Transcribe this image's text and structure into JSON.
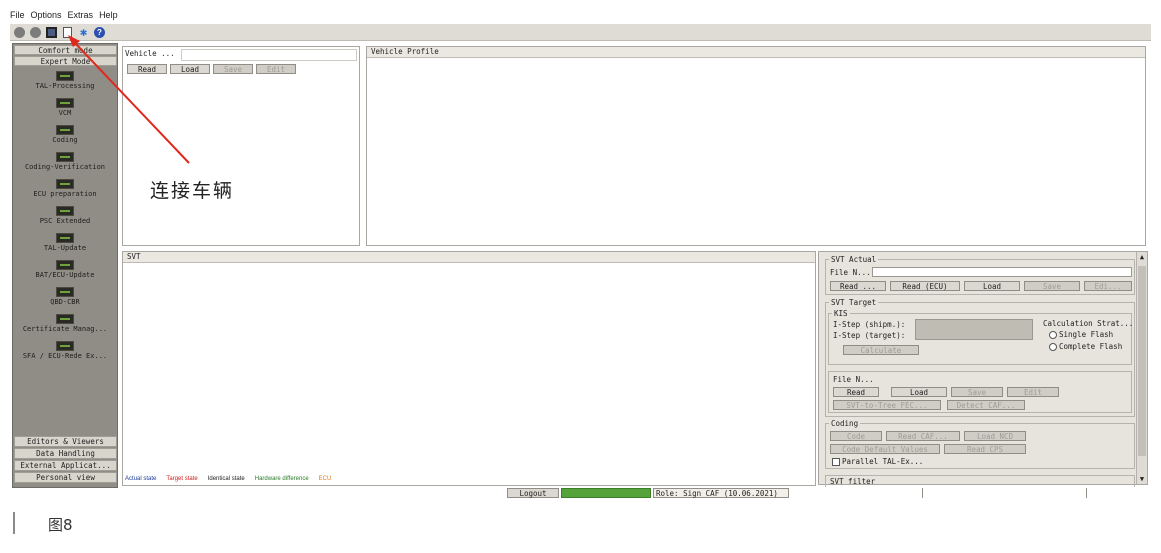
{
  "menu": [
    "File",
    "Options",
    "Extras",
    "Help"
  ],
  "toolbar": {
    "icons": [
      "disconnect-icon",
      "status-icon",
      "connect-vehicle-icon",
      "document-icon",
      "star-icon",
      "help-icon"
    ]
  },
  "sidebar": {
    "header_top": "Comfort mode",
    "header_sub": "Expert Mode",
    "items": [
      {
        "label": "TAL-Processing"
      },
      {
        "label": "VCM"
      },
      {
        "label": "Coding"
      },
      {
        "label": "Coding-Verification"
      },
      {
        "label": "ECU preparation"
      },
      {
        "label": "PSC Extended"
      },
      {
        "label": "TAL-Update"
      },
      {
        "label": "BAT/ECU-Update"
      },
      {
        "label": "QBD-CBR"
      },
      {
        "label": "Certificate Manag..."
      },
      {
        "label": "SFA / ECU-Rede Ex..."
      }
    ],
    "footer": [
      "Editors & Viewers",
      "Data Handling",
      "External Applicat...",
      "Personal view"
    ]
  },
  "vehicle_panel": {
    "label": "Vehicle ...",
    "buttons": [
      "Read",
      "Load",
      "Save",
      "Edit"
    ]
  },
  "vehicle_profile": {
    "title": "Vehicle Profile"
  },
  "svt_panel": {
    "title": "SVT"
  },
  "legend": {
    "actual": "Actual state",
    "target": "Target state",
    "identical": "Identical state",
    "hardware": "Hardware difference",
    "ecu": "ECU"
  },
  "colors": {
    "actual": "#1d3d9e",
    "target": "#d02020",
    "identical": "#222222",
    "hardware": "#2a7a2a",
    "ecu": "#e07a1a"
  },
  "right_panel": {
    "svt_actual": {
      "title": "SVT Actual",
      "file_label": "File N...",
      "buttons": [
        "Read ...",
        "Read (ECU)",
        "Load",
        "Save",
        "Edi..."
      ]
    },
    "svt_target": {
      "title": "SVT Target",
      "kis": "KIS",
      "istep_shipm": "I-Step (shipm.):",
      "istep_target": "I-Step (target):",
      "calc_strategy": "Calculation Strat...",
      "single_flash": "Single Flash",
      "complete_flash": "Complete Flash",
      "calculate": "Calculate"
    },
    "file_block": {
      "file_label": "File N...",
      "buttons": [
        "Read",
        "Load",
        "Save",
        "Edit"
      ],
      "buttons2": [
        "SVT-to-Tree FEC...",
        "Detect CAF..."
      ]
    },
    "coding": {
      "title": "Coding",
      "buttons": [
        "Code",
        "Read CAF...",
        "Load NCD"
      ],
      "buttons2": [
        "Code Default Values",
        "Read CPS"
      ],
      "parallel": "Parallel TAL-Ex..."
    },
    "svt_filter": {
      "title": "SVT filter"
    }
  },
  "statusbar": {
    "logout": "Logout",
    "role": "Role: Sign CAF (10.06.2021)"
  },
  "annotation": {
    "text": "连接车辆"
  },
  "caption": {
    "text": "图8"
  }
}
